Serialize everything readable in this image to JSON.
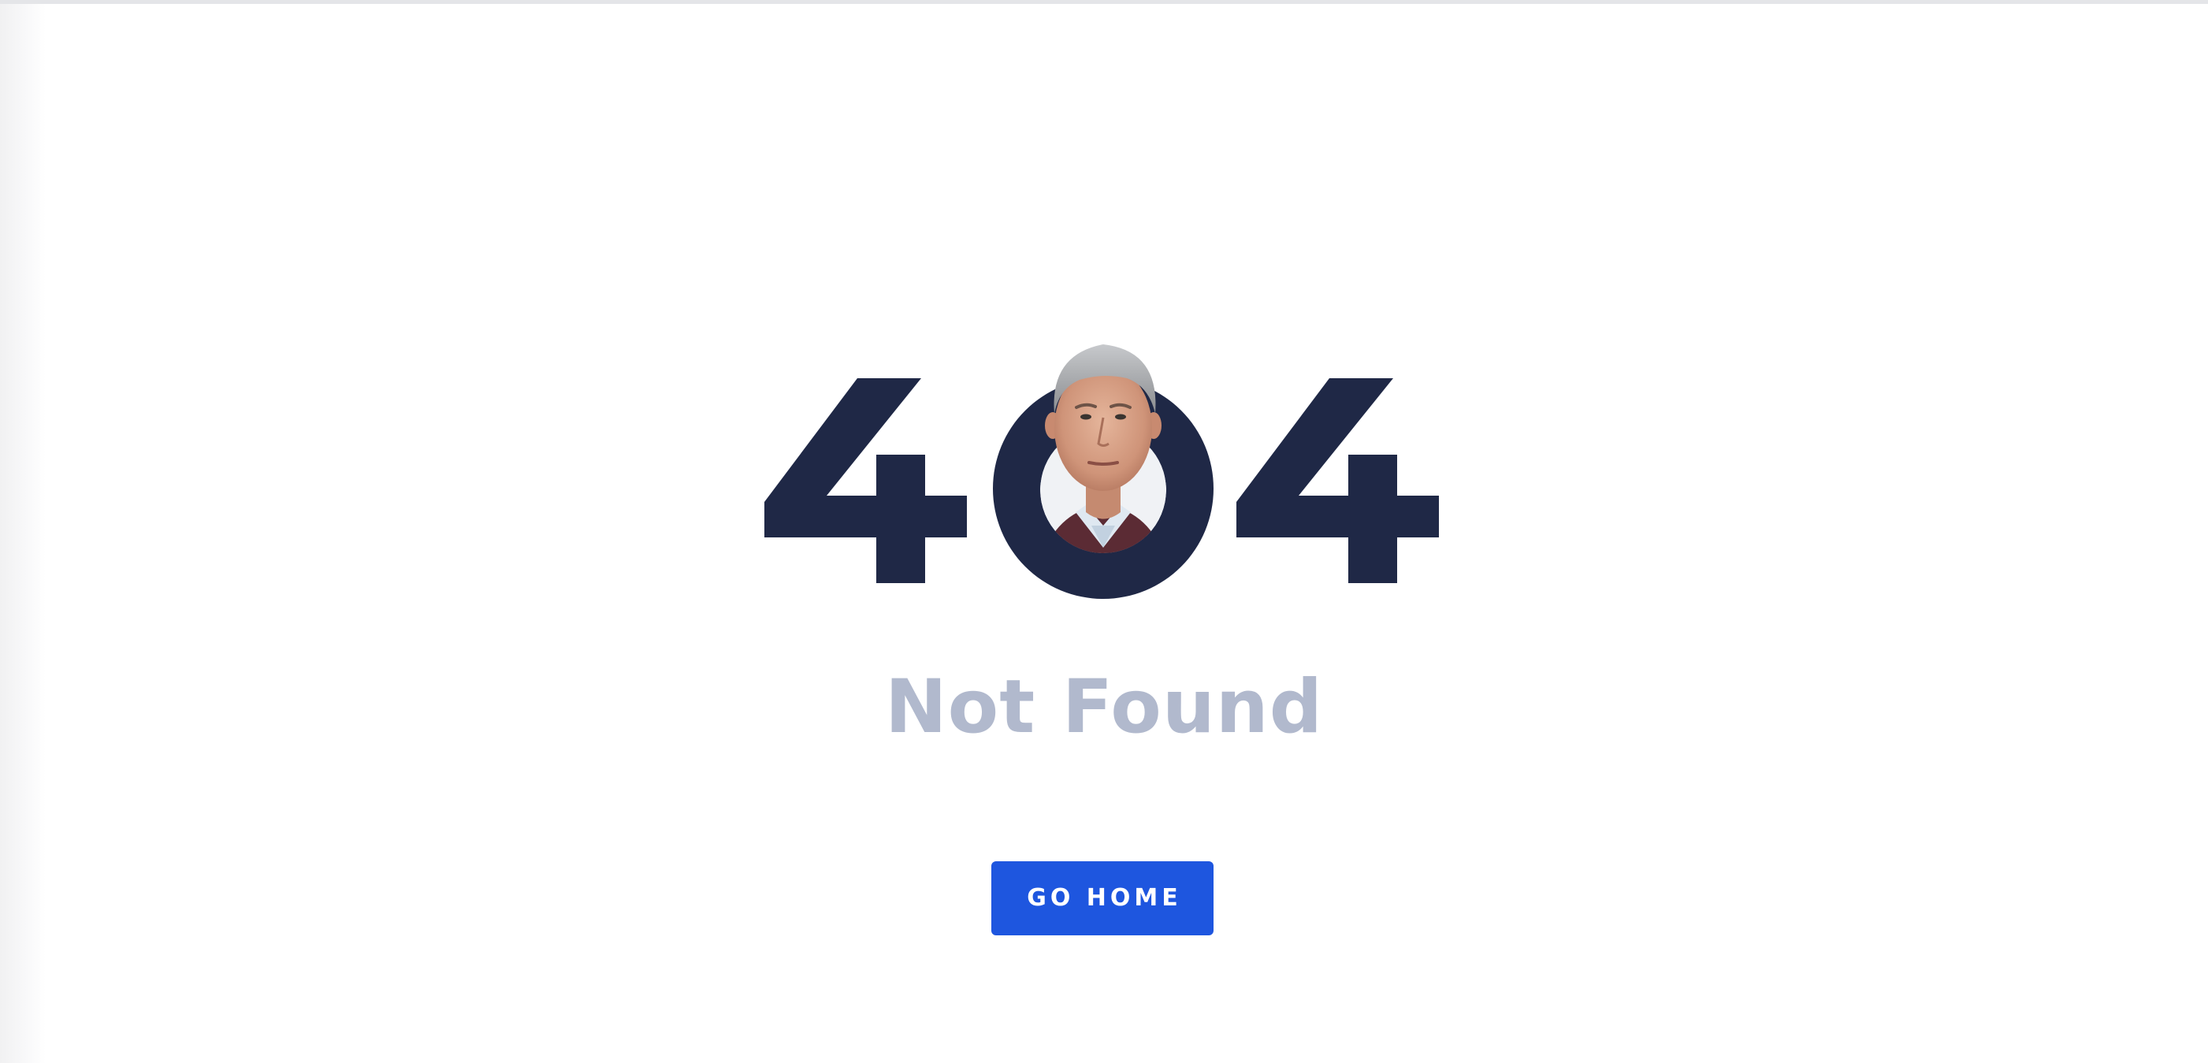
{
  "error": {
    "code_digits": [
      "4",
      "0",
      "4"
    ],
    "message": "Not Found"
  },
  "actions": {
    "go_home_label": "GO HOME"
  },
  "colors": {
    "digits": "#1f2846",
    "message": "#b1b9cd",
    "button_background": "#1e56df",
    "button_text": "#ffffff",
    "page_background": "#ffffff"
  },
  "images": {
    "portrait": "portrait of a gray-haired man in a collared shirt and dark sweater"
  }
}
